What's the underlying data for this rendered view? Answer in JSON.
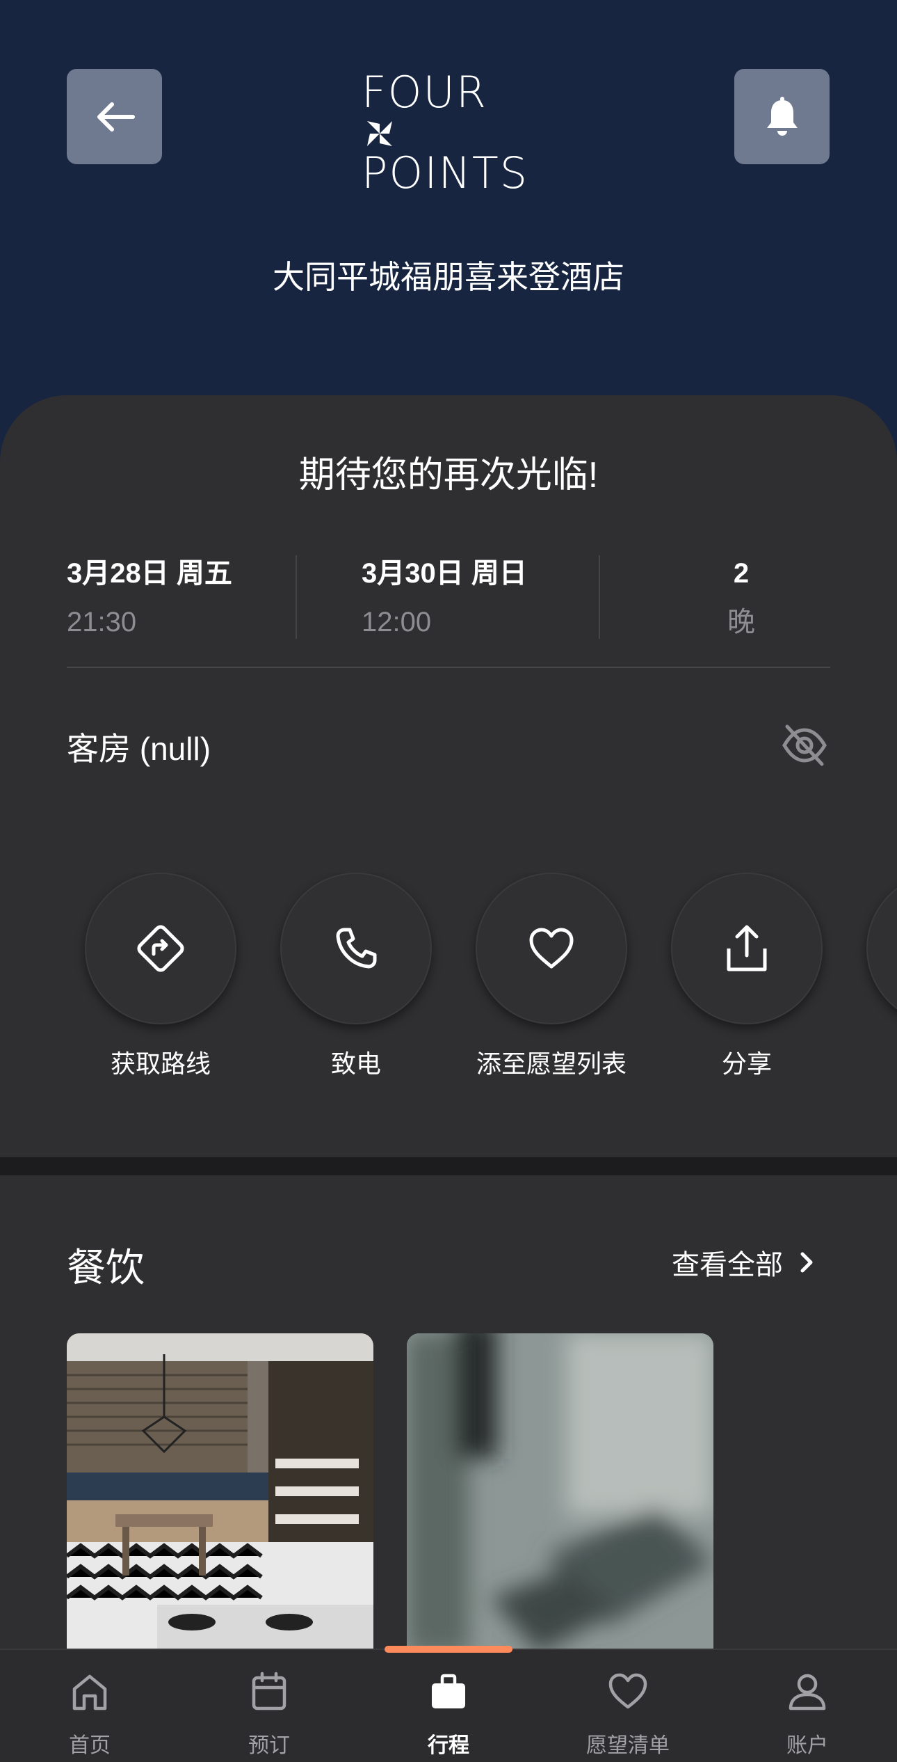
{
  "header": {
    "logo_line1": "FOUR",
    "logo_line2": "POINTS",
    "hotel_name": "大同平城福朋喜来登酒店"
  },
  "stay": {
    "welcome": "期待您的再次光临!",
    "checkin_date": "3月28日 周五",
    "checkin_time": "21:30",
    "checkout_date": "3月30日 周日",
    "checkout_time": "12:00",
    "nights_count": "2",
    "nights_label": "晚",
    "room_label": "客房 (null)"
  },
  "actions": [
    {
      "label": "获取路线",
      "icon": "directions-icon"
    },
    {
      "label": "致电",
      "icon": "phone-icon"
    },
    {
      "label": "添至愿望列表",
      "icon": "heart-icon"
    },
    {
      "label": "分享",
      "icon": "share-icon"
    }
  ],
  "dining": {
    "title": "餐饮",
    "view_all": "查看全部"
  },
  "tabs": [
    {
      "label": "首页",
      "icon": "home-icon",
      "active": false
    },
    {
      "label": "预订",
      "icon": "calendar-icon",
      "active": false
    },
    {
      "label": "行程",
      "icon": "briefcase-icon",
      "active": true
    },
    {
      "label": "愿望清单",
      "icon": "heart-icon",
      "active": false
    },
    {
      "label": "账户",
      "icon": "user-icon",
      "active": false
    }
  ],
  "colors": {
    "header_bg": "#172540",
    "surface": "#2f2f31",
    "accent": "#ff8a5b",
    "muted_text": "#8e8e92"
  }
}
